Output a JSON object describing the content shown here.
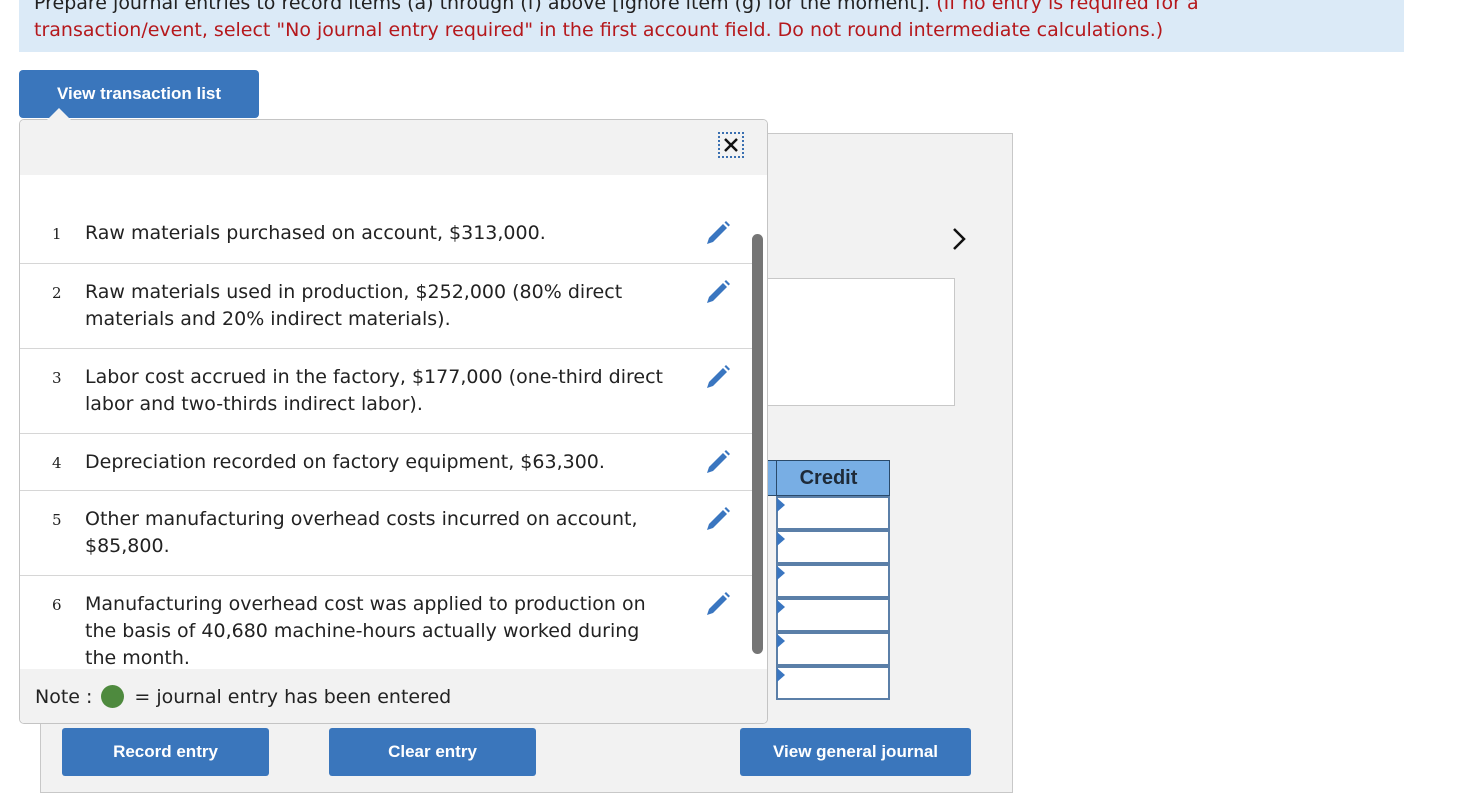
{
  "instructions": {
    "line1_black": "Prepare journal entries to record items (a) through (f) above [ignore item (g) for the moment]. ",
    "line1_red": "(If no entry is required for a",
    "line2_red": "transaction/event, select \"No journal entry required\" in the first account field. Do not round intermediate calculations.)"
  },
  "buttons": {
    "view_transaction_list": "View transaction list",
    "record_entry": "Record entry",
    "clear_entry": "Clear entry",
    "view_general_journal": "View general journal"
  },
  "journal_form": {
    "credit_header": "Credit",
    "credit_rows": [
      "",
      "",
      "",
      "",
      "",
      ""
    ],
    "next_icon": "chevron-right-icon"
  },
  "popup": {
    "close_icon": "close-icon",
    "transactions": [
      {
        "number": "1",
        "text": "Raw materials purchased on account, $313,000.",
        "icon": "pencil-icon"
      },
      {
        "number": "2",
        "text": "Raw materials used in production, $252,000 (80% direct materials and 20% indirect materials).",
        "icon": "pencil-icon"
      },
      {
        "number": "3",
        "text": "Labor cost accrued in the factory, $177,000 (one-third direct labor and two-thirds indirect labor).",
        "icon": "pencil-icon"
      },
      {
        "number": "4",
        "text": "Depreciation recorded on factory equipment, $63,300.",
        "icon": "pencil-icon"
      },
      {
        "number": "5",
        "text": "Other manufacturing overhead costs incurred on account, $85,800.",
        "icon": "pencil-icon"
      },
      {
        "number": "6",
        "text": "Manufacturing overhead cost was applied to production on the basis of 40,680 machine-hours actually worked during the month.",
        "icon": "pencil-icon"
      }
    ],
    "note_prefix": "Note :",
    "note_suffix": "= journal entry has been entered",
    "note_dot_color": "#4e8a3e"
  },
  "colors": {
    "accent": "#3a76bc",
    "instruction_bg": "#dbeaf7",
    "instruction_red": "#b5181c",
    "table_header": "#78aee4"
  }
}
